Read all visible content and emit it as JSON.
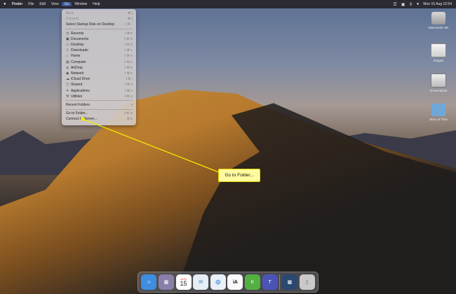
{
  "menubar": {
    "apple": "",
    "items": [
      "Finder",
      "File",
      "Edit",
      "View",
      "Go",
      "Window",
      "Help"
    ],
    "clock": "Mon 15 Aug  12:54"
  },
  "go_menu": {
    "items": [
      {
        "label": "Back",
        "shortcut": "⌘ [",
        "disabled": true
      },
      {
        "label": "Forward",
        "shortcut": "⌘ ]",
        "disabled": true
      },
      {
        "label": "Select Startup Disk on Desktop",
        "shortcut": "⇧⌘ ↑"
      },
      {
        "label": "Recents",
        "icon": "clock-icon",
        "shortcut": "⇧⌘ F"
      },
      {
        "label": "Documents",
        "icon": "document-icon",
        "shortcut": "⇧⌘ O"
      },
      {
        "label": "Desktop",
        "icon": "desktop-icon",
        "shortcut": "⇧⌘ D"
      },
      {
        "label": "Downloads",
        "icon": "download-icon",
        "shortcut": "⌥⌘ L"
      },
      {
        "label": "Home",
        "icon": "home-icon",
        "shortcut": "⇧⌘ H"
      },
      {
        "label": "Computer",
        "icon": "computer-icon",
        "shortcut": "⇧⌘ C"
      },
      {
        "label": "AirDrop",
        "icon": "airdrop-icon",
        "shortcut": "⇧⌘ R"
      },
      {
        "label": "Network",
        "icon": "network-icon",
        "shortcut": "⇧⌘ K"
      },
      {
        "label": "iCloud Drive",
        "icon": "cloud-icon",
        "shortcut": "⇧⌘ I"
      },
      {
        "label": "Shared",
        "icon": "shared-folder-icon",
        "shortcut": "⇧⌘ S"
      },
      {
        "label": "Applications",
        "icon": "applications-icon",
        "shortcut": "⇧⌘ A"
      },
      {
        "label": "Utilities",
        "icon": "utilities-icon",
        "shortcut": "⇧⌘ U"
      },
      {
        "label": "Recent Folders",
        "submenu": true
      },
      {
        "label": "Go to Folder...",
        "shortcut": "⇧⌘ G"
      },
      {
        "label": "Connect to Server...",
        "shortcut": "⌘ K"
      }
    ]
  },
  "callout": {
    "text": "Go to Folder..."
  },
  "desktop_icons": [
    "Macintosh HD",
    "Images",
    "Screenshots",
    "Story of Thor"
  ],
  "dock": {
    "calendar_month": "AUG",
    "calendar_day": "15",
    "ia_label": "iA"
  }
}
